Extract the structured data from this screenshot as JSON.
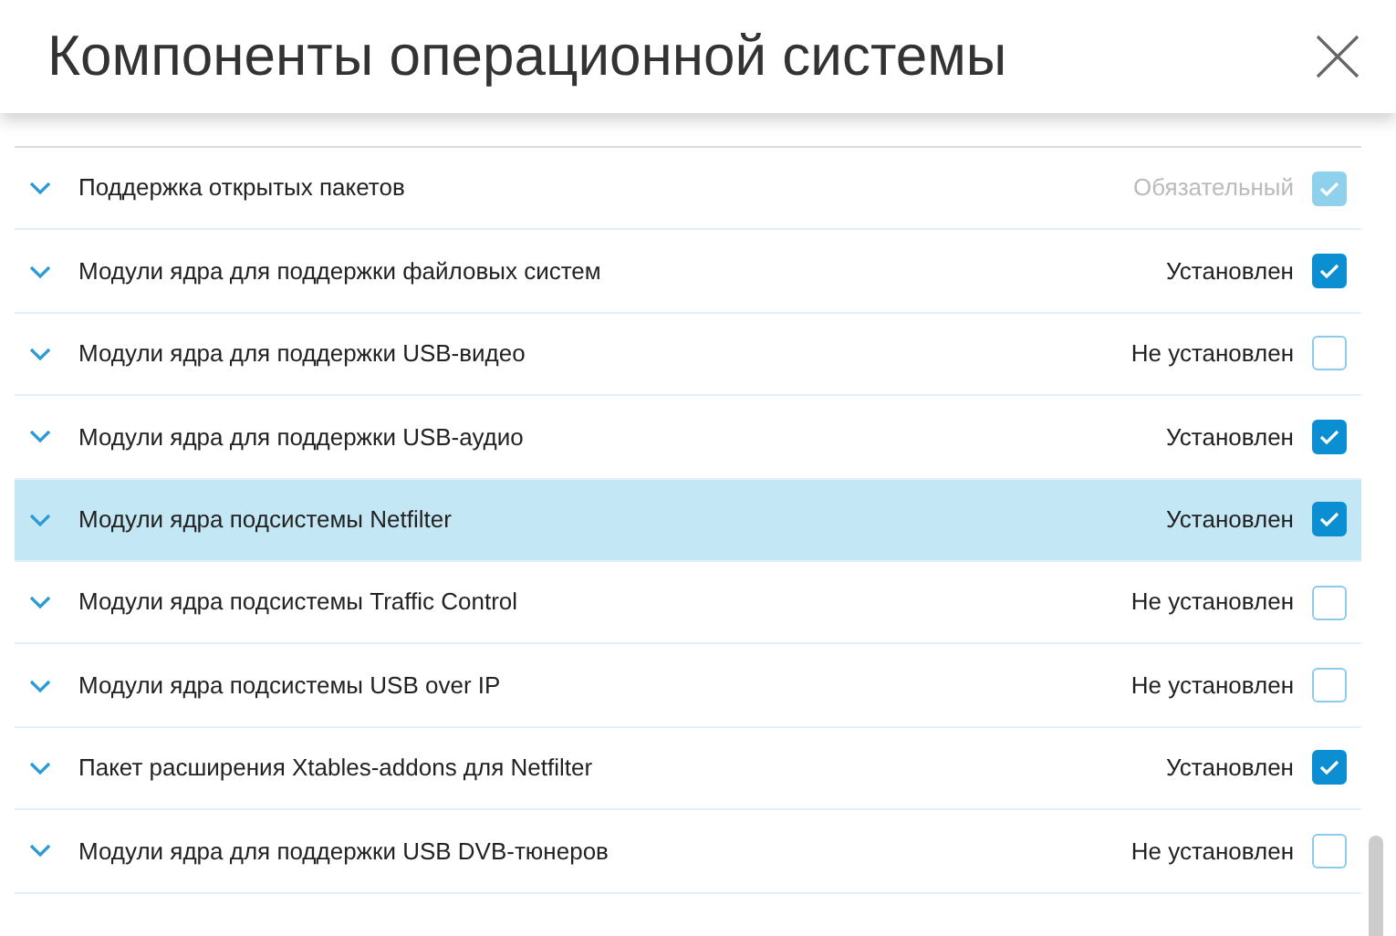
{
  "window": {
    "title": "Компоненты операционной системы"
  },
  "components": [
    {
      "name": "Поддержка открытых пакетов",
      "status": "Обязательный",
      "checked": true,
      "disabled": true,
      "selected": false
    },
    {
      "name": "Модули ядра для поддержки файловых систем",
      "status": "Установлен",
      "checked": true,
      "disabled": false,
      "selected": false
    },
    {
      "name": "Модули ядра для поддержки USB-видео",
      "status": "Не установлен",
      "checked": false,
      "disabled": false,
      "selected": false
    },
    {
      "name": "Модули ядра для поддержки USB-аудио",
      "status": "Установлен",
      "checked": true,
      "disabled": false,
      "selected": false
    },
    {
      "name": "Модули ядра подсистемы Netfilter",
      "status": "Установлен",
      "checked": true,
      "disabled": false,
      "selected": true
    },
    {
      "name": "Модули ядра подсистемы Traffic Control",
      "status": "Не установлен",
      "checked": false,
      "disabled": false,
      "selected": false
    },
    {
      "name": "Модули ядра подсистемы USB over IP",
      "status": "Не установлен",
      "checked": false,
      "disabled": false,
      "selected": false
    },
    {
      "name": "Пакет расширения Xtables-addons для Netfilter",
      "status": "Установлен",
      "checked": true,
      "disabled": false,
      "selected": false
    },
    {
      "name": "Модули ядра для поддержки USB DVB-тюнеров",
      "status": "Не установлен",
      "checked": false,
      "disabled": false,
      "selected": false
    }
  ]
}
